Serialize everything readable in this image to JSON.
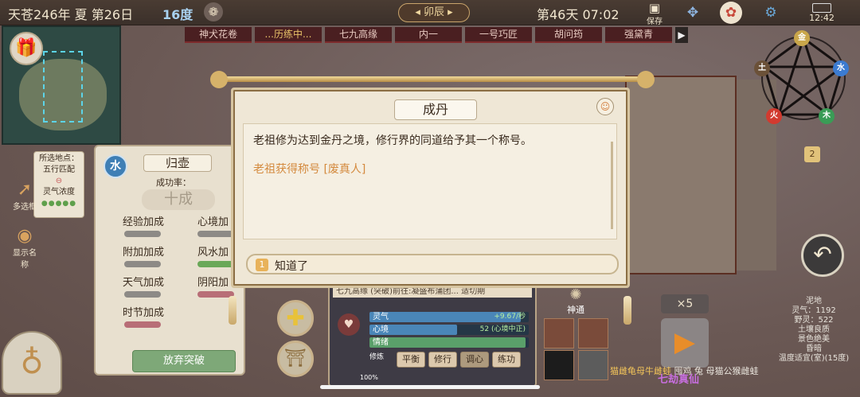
{
  "topbar": {
    "date": "天苍246年 夏 第26日",
    "temperature": "16度",
    "shichen": "卯辰",
    "day_time": "第46天 07:02",
    "save_label": "保存",
    "clock": "12:42"
  },
  "tasks": [
    {
      "label": "神犬花卷",
      "active": false
    },
    {
      "label": "...历练中...",
      "active": true
    },
    {
      "label": "七九高缘",
      "active": false
    },
    {
      "label": "内一",
      "active": false
    },
    {
      "label": "一号巧匠",
      "active": false
    },
    {
      "label": "胡问筠",
      "active": false
    },
    {
      "label": "强黛青",
      "active": false
    }
  ],
  "location_card": {
    "title": "所选地点：",
    "match": "五行匹配",
    "aura": "灵气浓度",
    "dots": "●●●●●"
  },
  "side_buttons": {
    "multi_select": "多选框",
    "show_names": "显示名称"
  },
  "breakthrough": {
    "element": "水",
    "title": "归壶",
    "rate_label": "成功率：",
    "rate": "十成",
    "items": [
      "经验加成",
      "心境加",
      "附加加成",
      "风水加",
      "天气加成",
      "阴阳加",
      "时节加成"
    ],
    "abandon": "放弃突破"
  },
  "dialog": {
    "title": "成丹",
    "line1": "老祖修为达到金丹之境，修行界的同道给予其一个称号。",
    "line2": "老祖获得称号 [废真人]",
    "option_num": "1",
    "option_text": "知道了"
  },
  "character": {
    "header": "七九高缘  (突破)前往:凝盛布蒲团...  适切期",
    "stats": [
      {
        "label": "灵气",
        "value": "+9.67/秒",
        "fill": 0.95,
        "color": "#4a86b8"
      },
      {
        "label": "心境",
        "value": "52 (心境中正)",
        "fill": 0.55,
        "color": "#4a86b8"
      },
      {
        "label": "情绪",
        "value": "",
        "fill": 0.98,
        "color": "#5aa06a"
      }
    ],
    "mode_title": "修炼",
    "modes": [
      "平衡",
      "修行",
      "调心",
      "练功"
    ],
    "active_mode": 2,
    "percent": "100%"
  },
  "shentong": "神通",
  "wuxing": {
    "metal": "金",
    "water": "水",
    "wood": "木",
    "fire": "火",
    "earth": "土"
  },
  "talk_bubble": "2",
  "tile_info": {
    "lines": [
      "泥地",
      "灵气：1192",
      "野灵：522",
      "土壤良质",
      "景色绝美",
      "昏暗",
      "温度适宜(室)(15度)"
    ]
  },
  "speed": "×5",
  "animals": "猫雌龟母牛雌蛙",
  "animals2": "囤鸡 兔 母猫公猴雌蛙",
  "realm": "七劫真仙"
}
